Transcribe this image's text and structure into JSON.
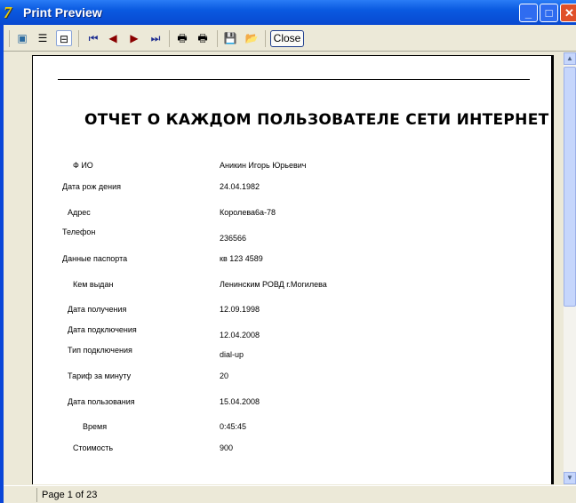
{
  "window": {
    "title": "Print Preview",
    "minimize": "_",
    "maximize": "□",
    "close": "✕"
  },
  "toolbar": {
    "close_label": "Close"
  },
  "report": {
    "title": "ОТЧЕТ О КАЖДОМ ПОЛЬЗОВАТЕЛЕ СЕТИ ИНТЕРНЕТ",
    "fields": [
      {
        "label": "Ф ИО",
        "value": "Аникин Игорь Юрьевич"
      },
      {
        "label": "Дата рож дения",
        "value": "24.04.1982"
      },
      {
        "label": "Адрес",
        "value": "Королева6а-78"
      },
      {
        "label": "Телефон",
        "value": "236566"
      },
      {
        "label": "Данные паспорта",
        "value": "кв 123 4589"
      },
      {
        "label": "Кем выдан",
        "value": "Ленинским РОВД г.Могилева"
      },
      {
        "label": "Дата получения",
        "value": "12.09.1998"
      },
      {
        "label": "Дата подключения",
        "value": "12.04.2008"
      },
      {
        "label": "Тип подключения",
        "value": "dial-up"
      },
      {
        "label": "Тариф за минуту",
        "value": "20"
      },
      {
        "label": "Дата пользования",
        "value": "15.04.2008"
      },
      {
        "label": "Время",
        "value": "0:45:45"
      },
      {
        "label": "Стоимость",
        "value": "900"
      }
    ]
  },
  "status": {
    "page": "Page 1 of 23"
  }
}
